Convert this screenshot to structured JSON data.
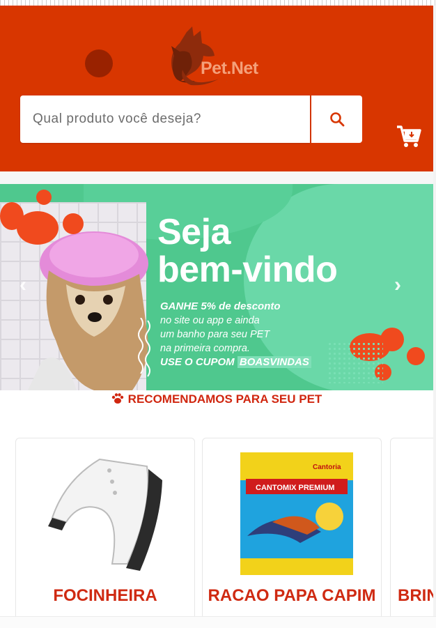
{
  "header": {
    "logo_text": "Pet.Net",
    "search_placeholder": "Qual produto você deseja?",
    "search_button_icon": "search-icon",
    "cart_icon": "cart-icon",
    "accent": "#d83600"
  },
  "banner": {
    "headline_line1": "Seja",
    "headline_line2": "bem-vindo",
    "promo_bold": "GANHE 5% de desconto",
    "promo_line2": "no site ou app e ainda",
    "promo_line3": "um banho para seu PET",
    "promo_line4": "na primeira compra.",
    "coupon_prefix": "USE O CUPOM",
    "coupon_code": "BOASVINDAS",
    "prev_arrow": "‹",
    "next_arrow": "›"
  },
  "recommend": {
    "title": "RECOMENDAMOS PARA SEU PET",
    "icon": "paw-icon"
  },
  "products": [
    {
      "name": "FOCINHEIRA"
    },
    {
      "name": "RACAO PAPA CAPIM"
    },
    {
      "name": "BRIN"
    }
  ],
  "package": {
    "brand": "Cantoria",
    "product": "CANTOMIX PREMIUM"
  }
}
